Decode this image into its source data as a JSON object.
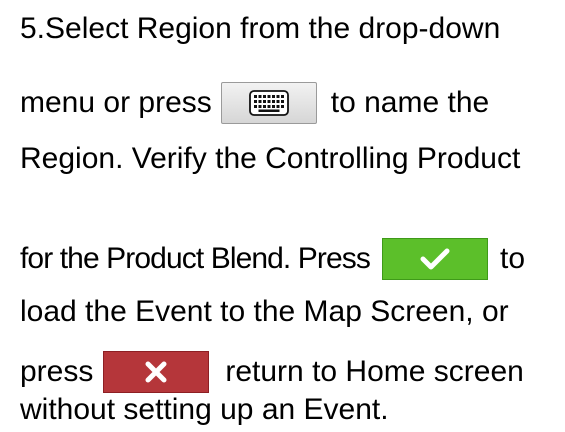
{
  "instruction": {
    "line1": "5.Select Region from the drop-down",
    "line2_before": "menu or press",
    "line2_after": "to name the",
    "line3": "Region. Verify the Controlling Product",
    "line4_before": "for the Product Blend. Press",
    "line4_after": "to",
    "line5": "load the Event to the Map Screen, or",
    "line6_before": "press",
    "line6_after": "return to Home screen",
    "line7": "without setting up an Event."
  },
  "buttons": {
    "keyboard": {
      "icon": "keyboard-icon"
    },
    "accept": {
      "icon": "checkmark-icon",
      "color": "#5cbf2a"
    },
    "cancel": {
      "icon": "close-icon",
      "color": "#b5363a"
    }
  }
}
